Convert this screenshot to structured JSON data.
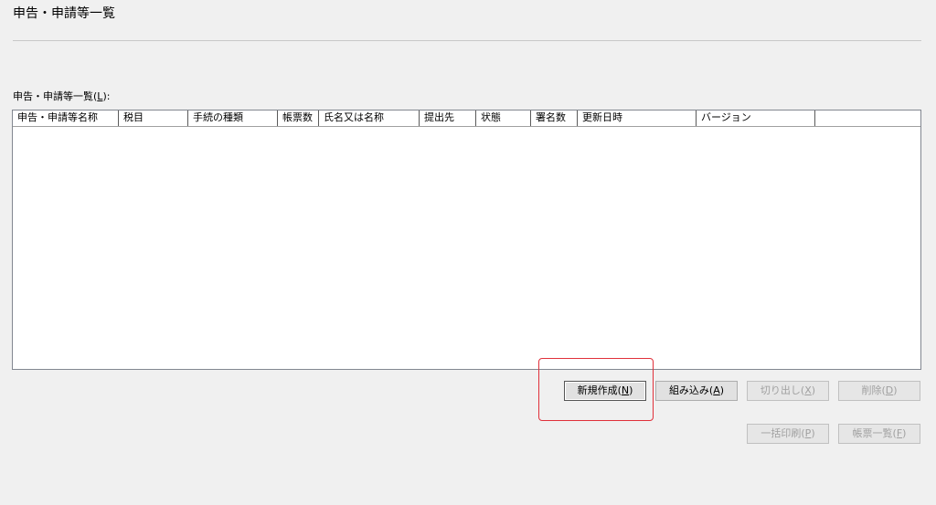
{
  "window": {
    "title": "申告・申請等一覧"
  },
  "list": {
    "label": "申告・申請等一覧(",
    "label_mnemonic": "L",
    "label_suffix": "):",
    "columns": [
      {
        "label": "申告・申請等名称"
      },
      {
        "label": "税目"
      },
      {
        "label": "手続の種類"
      },
      {
        "label": "帳票数"
      },
      {
        "label": "氏名又は名称"
      },
      {
        "label": "提出先"
      },
      {
        "label": "状態"
      },
      {
        "label": "署名数"
      },
      {
        "label": "更新日時"
      },
      {
        "label": "バージョン"
      }
    ],
    "rows": []
  },
  "buttons": {
    "new": {
      "label": "新規作成(",
      "mnemonic": "N",
      "suffix": ")"
    },
    "import": {
      "label": "組み込み(",
      "mnemonic": "A",
      "suffix": ")"
    },
    "export": {
      "label": "切り出し(",
      "mnemonic": "X",
      "suffix": ")"
    },
    "delete": {
      "label": "削除(",
      "mnemonic": "D",
      "suffix": ")"
    },
    "batch_print": {
      "label": "一括印刷(",
      "mnemonic": "P",
      "suffix": ")"
    },
    "form_list": {
      "label": "帳票一覧(",
      "mnemonic": "F",
      "suffix": ")"
    }
  },
  "colors": {
    "highlight": "#e0303a",
    "window_bg": "#f0f0f0"
  }
}
